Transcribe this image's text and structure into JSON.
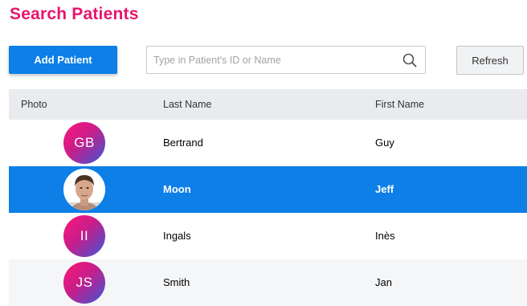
{
  "header": {
    "title": "Search Patients"
  },
  "toolbar": {
    "add_label": "Add Patient",
    "search_placeholder": "Type in Patient's ID or Name",
    "search_value": "",
    "refresh_label": "Refresh"
  },
  "table": {
    "columns": [
      "Photo",
      "Last Name",
      "First Name"
    ],
    "rows": [
      {
        "photo_initials": "GB",
        "last_name": "Bertrand",
        "first_name": "Guy",
        "selected": false
      },
      {
        "photo_initials": "",
        "has_photo": true,
        "last_name": "Moon",
        "first_name": "Jeff",
        "selected": true
      },
      {
        "photo_initials": "II",
        "last_name": "Ingals",
        "first_name": "Inès",
        "selected": false
      },
      {
        "photo_initials": "JS",
        "last_name": "Smith",
        "first_name": "Jan",
        "selected": false
      }
    ]
  },
  "colors": {
    "title": "#e6166b",
    "primary": "#0d7fe6",
    "header_bg": "#e9ebee",
    "stripe_bg": "#f5f6f8",
    "avatar_gradient": [
      "#ff1578",
      "#c81e8a",
      "#3a57d8"
    ]
  },
  "icons": {
    "search": "search-icon"
  }
}
